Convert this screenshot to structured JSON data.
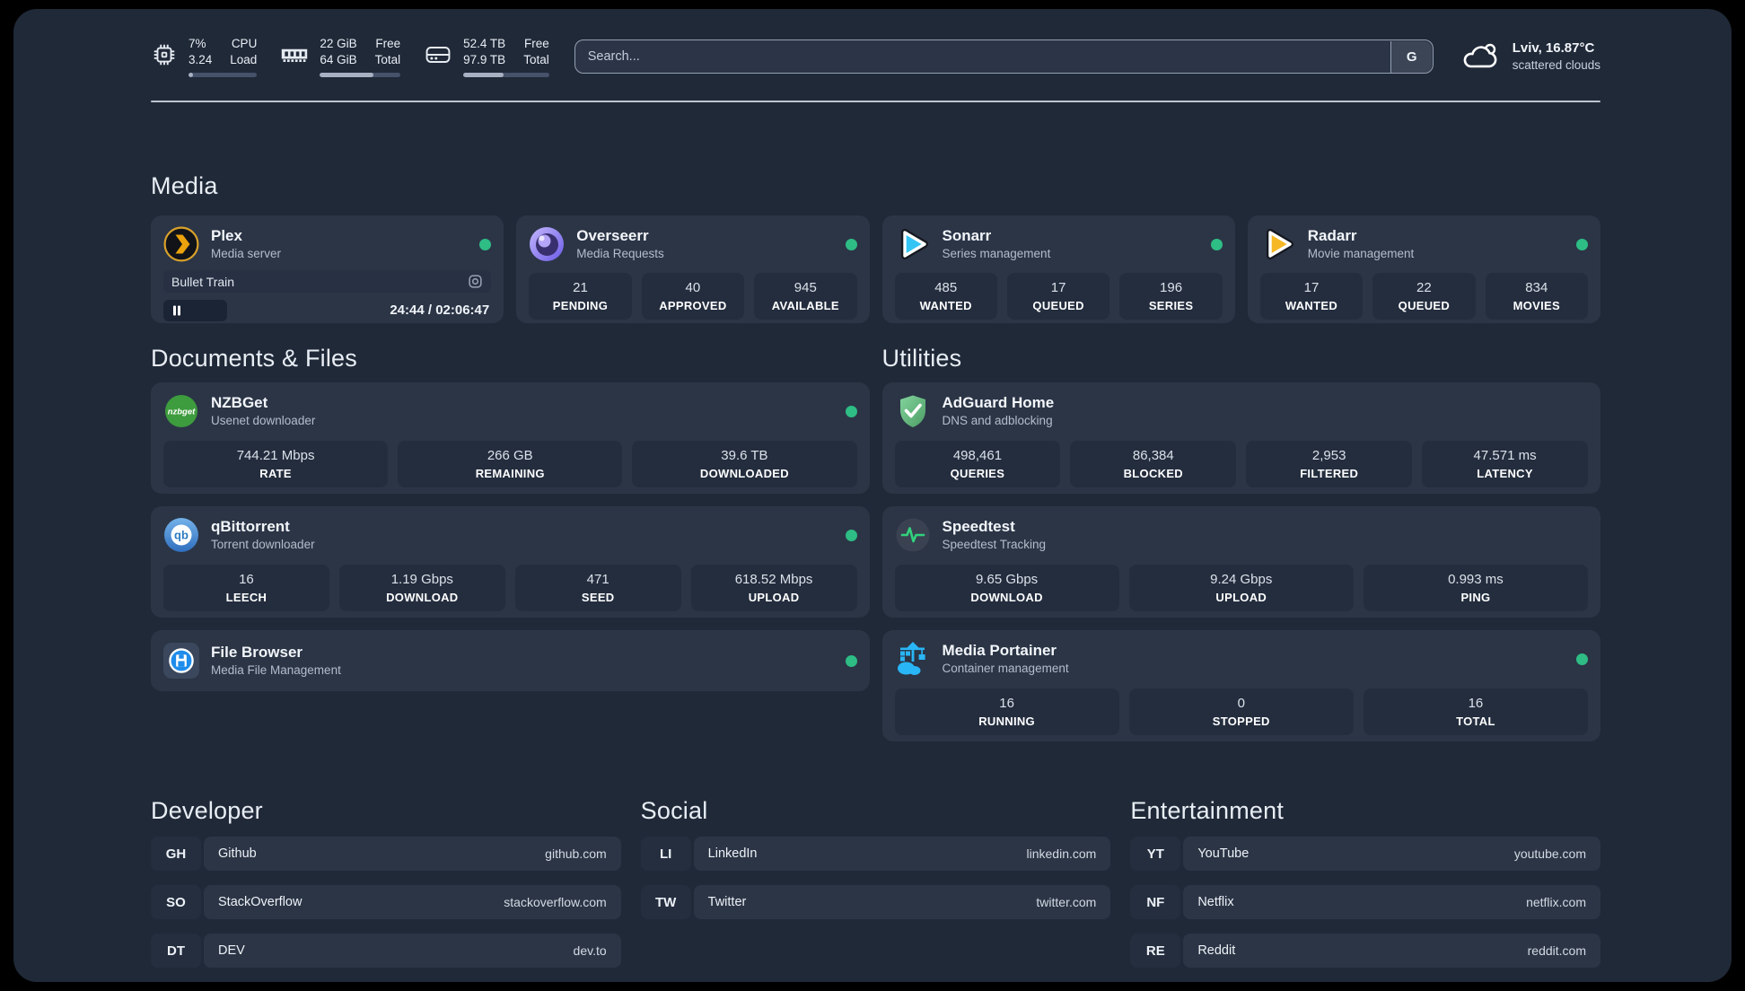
{
  "header": {
    "stats": [
      {
        "icon": "cpu-icon",
        "value_top": "7%",
        "value_bottom": "3.24",
        "label_top": "CPU",
        "label_bottom": "Load",
        "progress_pct": 7
      },
      {
        "icon": "memory-icon",
        "value_top": "22 GiB",
        "value_bottom": "64 GiB",
        "label_top": "Free",
        "label_bottom": "Total",
        "progress_pct": 66
      },
      {
        "icon": "disk-icon",
        "value_top": "52.4 TB",
        "value_bottom": "97.9 TB",
        "label_top": "Free",
        "label_bottom": "Total",
        "progress_pct": 47
      }
    ],
    "search": {
      "placeholder": "Search...",
      "engine_button": "G"
    },
    "weather": {
      "icon": "cloud-icon",
      "title": "Lviv, 16.87°C",
      "subtitle": "scattered clouds"
    }
  },
  "sections": {
    "media": {
      "title": "Media",
      "plex": {
        "icon": "plex-icon",
        "title": "Plex",
        "subtitle": "Media server",
        "status": "online",
        "player": {
          "track": "Bullet Train",
          "time": "24:44 / 02:06:47",
          "progress_pct": 19.5
        }
      },
      "overseerr": {
        "icon": "overseerr-icon",
        "title": "Overseerr",
        "subtitle": "Media Requests",
        "status": "online",
        "stats": [
          {
            "value": "21",
            "label": "PENDING"
          },
          {
            "value": "40",
            "label": "APPROVED"
          },
          {
            "value": "945",
            "label": "AVAILABLE"
          }
        ]
      },
      "sonarr": {
        "icon": "sonarr-icon",
        "title": "Sonarr",
        "subtitle": "Series management",
        "status": "online",
        "stats": [
          {
            "value": "485",
            "label": "WANTED"
          },
          {
            "value": "17",
            "label": "QUEUED"
          },
          {
            "value": "196",
            "label": "SERIES"
          }
        ]
      },
      "radarr": {
        "icon": "radarr-icon",
        "title": "Radarr",
        "subtitle": "Movie management",
        "status": "online",
        "stats": [
          {
            "value": "17",
            "label": "WANTED"
          },
          {
            "value": "22",
            "label": "QUEUED"
          },
          {
            "value": "834",
            "label": "MOVIES"
          }
        ]
      }
    },
    "documents": {
      "title": "Documents & Files",
      "nzbget": {
        "icon": "nzbget-icon",
        "title": "NZBGet",
        "subtitle": "Usenet downloader",
        "status": "online",
        "stats": [
          {
            "value": "744.21 Mbps",
            "label": "RATE"
          },
          {
            "value": "266 GB",
            "label": "REMAINING"
          },
          {
            "value": "39.6 TB",
            "label": "DOWNLOADED"
          }
        ]
      },
      "qbittorrent": {
        "icon": "qbittorrent-icon",
        "title": "qBittorrent",
        "subtitle": "Torrent downloader",
        "status": "online",
        "stats": [
          {
            "value": "16",
            "label": "LEECH"
          },
          {
            "value": "1.19 Gbps",
            "label": "DOWNLOAD"
          },
          {
            "value": "471",
            "label": "SEED"
          },
          {
            "value": "618.52 Mbps",
            "label": "UPLOAD"
          }
        ]
      },
      "filebrowser": {
        "icon": "filebrowser-icon",
        "title": "File Browser",
        "subtitle": "Media File Management",
        "status": "online"
      }
    },
    "utilities": {
      "title": "Utilities",
      "adguard": {
        "icon": "adguard-icon",
        "title": "AdGuard Home",
        "subtitle": "DNS and adblocking",
        "status": "online",
        "stats": [
          {
            "value": "498,461",
            "label": "QUERIES"
          },
          {
            "value": "86,384",
            "label": "BLOCKED"
          },
          {
            "value": "2,953",
            "label": "FILTERED"
          },
          {
            "value": "47.571 ms",
            "label": "LATENCY"
          }
        ]
      },
      "speedtest": {
        "icon": "speedtest-icon",
        "title": "Speedtest",
        "subtitle": "Speedtest Tracking",
        "stats": [
          {
            "value": "9.65 Gbps",
            "label": "DOWNLOAD"
          },
          {
            "value": "9.24 Gbps",
            "label": "UPLOAD"
          },
          {
            "value": "0.993 ms",
            "label": "PING"
          }
        ]
      },
      "portainer": {
        "icon": "portainer-icon",
        "title": "Media Portainer",
        "subtitle": "Container management",
        "status": "online",
        "stats": [
          {
            "value": "16",
            "label": "RUNNING"
          },
          {
            "value": "0",
            "label": "STOPPED"
          },
          {
            "value": "16",
            "label": "TOTAL"
          }
        ]
      }
    },
    "links": {
      "developer": {
        "title": "Developer",
        "items": [
          {
            "abbr": "GH",
            "name": "Github",
            "url": "github.com"
          },
          {
            "abbr": "SO",
            "name": "StackOverflow",
            "url": "stackoverflow.com"
          },
          {
            "abbr": "DT",
            "name": "DEV",
            "url": "dev.to"
          }
        ]
      },
      "social": {
        "title": "Social",
        "items": [
          {
            "abbr": "LI",
            "name": "LinkedIn",
            "url": "linkedin.com"
          },
          {
            "abbr": "TW",
            "name": "Twitter",
            "url": "twitter.com"
          }
        ]
      },
      "entertainment": {
        "title": "Entertainment",
        "items": [
          {
            "abbr": "YT",
            "name": "YouTube",
            "url": "youtube.com"
          },
          {
            "abbr": "NF",
            "name": "Netflix",
            "url": "netflix.com"
          },
          {
            "abbr": "RE",
            "name": "Reddit",
            "url": "reddit.com"
          }
        ]
      }
    }
  },
  "colors": {
    "page_background": "#202938",
    "card_background": "#2b3546",
    "tile_background": "#232d3e",
    "status_online": "#2ebd85",
    "plex_gold": "#eba20c",
    "sonarr_blue": "#35c5f4",
    "radarr_yellow": "#f7b825",
    "adguard_green": "#5fb77d",
    "portainer_blue": "#29b6f6",
    "speedtest_pulse": "#31d27c"
  }
}
